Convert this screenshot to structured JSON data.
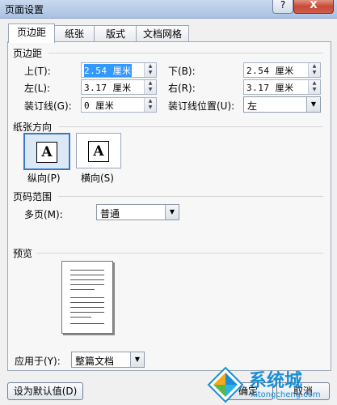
{
  "window": {
    "title": "页面设置",
    "help_label": "?",
    "close_label": "X"
  },
  "tabs": [
    {
      "label": "页边距",
      "active": true
    },
    {
      "label": "纸张",
      "active": false
    },
    {
      "label": "版式",
      "active": false
    },
    {
      "label": "文档网格",
      "active": false
    }
  ],
  "margins": {
    "heading": "页边距",
    "top": {
      "label": "上(T):",
      "value": "2.54 厘米"
    },
    "bottom": {
      "label": "下(B):",
      "value": "2.54 厘米"
    },
    "left": {
      "label": "左(L):",
      "value": "3.17 厘米"
    },
    "right": {
      "label": "右(R):",
      "value": "3.17 厘米"
    },
    "gutter": {
      "label": "装订线(G):",
      "value": "0 厘米"
    },
    "gutter_pos": {
      "label": "装订线位置(U):",
      "value": "左"
    }
  },
  "orientation": {
    "heading": "纸张方向",
    "glyph": "A",
    "portrait_label": "纵向(P)",
    "landscape_label": "横向(S)",
    "selected": "portrait"
  },
  "pages": {
    "heading": "页码范围",
    "multiple_label": "多页(M):",
    "multiple_value": "普通"
  },
  "preview": {
    "heading": "预览",
    "apply_label": "应用于(Y):",
    "apply_value": "整篇文档"
  },
  "buttons": {
    "default_label": "设为默认值(D)",
    "ok_label": "确定",
    "cancel_label": "取消"
  },
  "watermark": {
    "brand": "系统城",
    "url": "xitongcheng.com"
  },
  "colors": {
    "selection": "#3399ff",
    "accent": "#3a78c4",
    "watermark_blue": "#1a8fd6"
  }
}
